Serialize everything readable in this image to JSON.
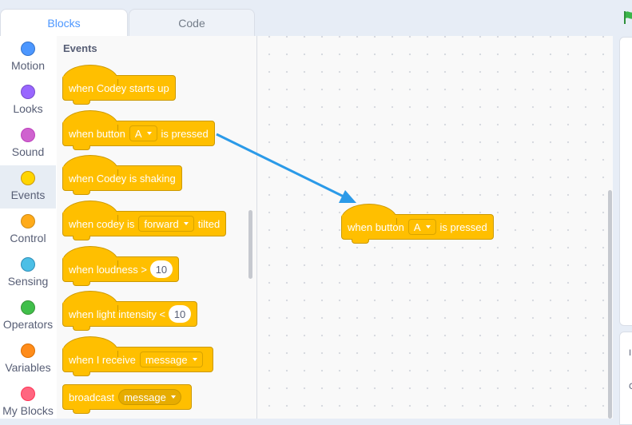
{
  "tabs": {
    "blocks": "Blocks",
    "code": "Code"
  },
  "categories": [
    {
      "label": "Motion",
      "color": "#4c97ff"
    },
    {
      "label": "Looks",
      "color": "#9966ff"
    },
    {
      "label": "Sound",
      "color": "#cf63cf"
    },
    {
      "label": "Events",
      "color": "#ffd500",
      "active": true
    },
    {
      "label": "Control",
      "color": "#ffab19"
    },
    {
      "label": "Sensing",
      "color": "#4cbfe6"
    },
    {
      "label": "Operators",
      "color": "#40bf4a"
    },
    {
      "label": "Variables",
      "color": "#ff8c1a"
    },
    {
      "label": "My Blocks",
      "color": "#ff6680"
    }
  ],
  "palette": {
    "title": "Events",
    "blocks": [
      {
        "text": "when Codey starts up"
      },
      {
        "pre": "when button",
        "dropdown": "A",
        "post": "is pressed"
      },
      {
        "text": "when Codey is shaking"
      },
      {
        "pre": "when codey is",
        "dropdown": "forward",
        "post": "tilted"
      },
      {
        "pre": "when loudness >",
        "number": "10"
      },
      {
        "pre": "when light intensity <",
        "number": "10"
      },
      {
        "pre": "when I receive",
        "dropdown": "message"
      },
      {
        "pre": "broadcast",
        "dropdown": "message"
      }
    ]
  },
  "workspace": {
    "block": {
      "pre": "when button",
      "dropdown": "A",
      "post": "is pressed"
    }
  },
  "right_panel": {
    "hint1": "I",
    "hint2": "C"
  },
  "colors": {
    "event_block": "#ffbf00",
    "tab_active_text": "#4d97ff",
    "arrow": "#2b9ae8",
    "flag": "#3bb54a"
  },
  "icons": {
    "run": "green-flag-icon",
    "drag_hint": "arrow-icon"
  }
}
